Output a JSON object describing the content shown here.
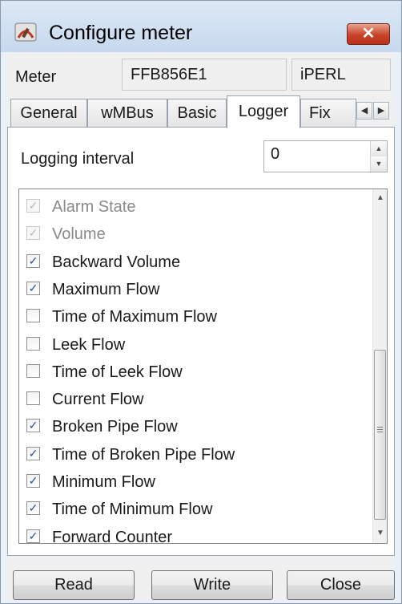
{
  "window": {
    "title": "Configure meter",
    "close_glyph": "✕",
    "icon": "meter-app-icon"
  },
  "meter": {
    "label": "Meter",
    "id": "FFB856E1",
    "model": "iPERL"
  },
  "tabs": [
    {
      "label": "General",
      "active": false
    },
    {
      "label": "wMBus",
      "active": false
    },
    {
      "label": "Basic",
      "active": false
    },
    {
      "label": "Logger",
      "active": true
    },
    {
      "label": "Fix",
      "active": false
    }
  ],
  "tab_scroll": {
    "left": "◀",
    "right": "▶"
  },
  "logger": {
    "interval_label": "Logging interval",
    "interval_value": "0",
    "items": [
      {
        "label": "Alarm State",
        "checked": true,
        "enabled": false
      },
      {
        "label": "Volume",
        "checked": true,
        "enabled": false
      },
      {
        "label": "Backward Volume",
        "checked": true,
        "enabled": true
      },
      {
        "label": "Maximum Flow",
        "checked": true,
        "enabled": true
      },
      {
        "label": "Time of Maximum Flow",
        "checked": false,
        "enabled": true
      },
      {
        "label": "Leek Flow",
        "checked": false,
        "enabled": true
      },
      {
        "label": "Time of Leek Flow",
        "checked": false,
        "enabled": true
      },
      {
        "label": "Current Flow",
        "checked": false,
        "enabled": true
      },
      {
        "label": "Broken Pipe Flow",
        "checked": true,
        "enabled": true
      },
      {
        "label": "Time of Broken Pipe Flow",
        "checked": true,
        "enabled": true
      },
      {
        "label": "Minimum Flow",
        "checked": true,
        "enabled": true
      },
      {
        "label": "Time of Minimum Flow",
        "checked": true,
        "enabled": true
      },
      {
        "label": "Forward Counter",
        "checked": true,
        "enabled": true
      }
    ]
  },
  "buttons": {
    "read": "Read",
    "write": "Write",
    "close": "Close"
  },
  "colors": {
    "check_mark": "#2b4fa0",
    "close_button": "#c7432a"
  }
}
